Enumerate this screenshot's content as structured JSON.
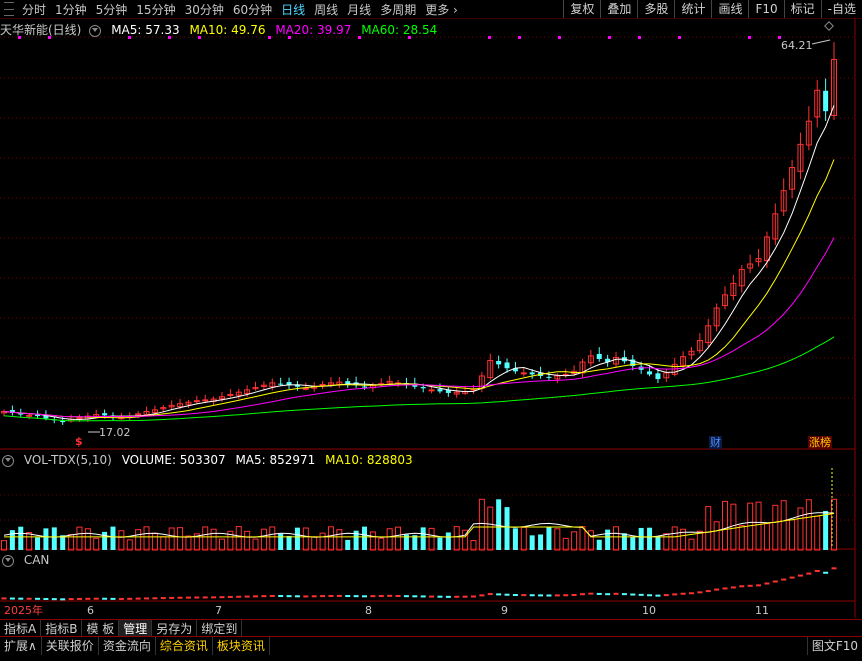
{
  "toolbar": {
    "periods": [
      "分时",
      "1分钟",
      "5分钟",
      "15分钟",
      "30分钟",
      "60分钟",
      "日线",
      "周线",
      "月线",
      "多周期",
      "更多"
    ],
    "active_period": "日线",
    "more_arrow": "›",
    "right_tools": [
      "复权",
      "叠加",
      "多股",
      "统计",
      "画线",
      "F10",
      "标记",
      "-自选"
    ]
  },
  "main_panel": {
    "title": "天华新能(日线)",
    "ma5": "MA5: 57.33",
    "ma10": "MA10: 49.76",
    "ma20": "MA20: 39.97",
    "ma60": "MA60: 28.54",
    "high_label": "64.21",
    "low_label": "17.02",
    "low_marker": "$",
    "tag_cai": "财",
    "tag_zhangbang": "涨榜",
    "colors": {
      "ma5": "#ffffff",
      "ma10": "#ffff00",
      "ma20": "#ff00ff",
      "ma60": "#00ff00",
      "up": "#ff3232",
      "down": "#54ffff"
    }
  },
  "volume_panel": {
    "title": "VOL-TDX(5,10)",
    "volume": "VOLUME: 503307",
    "ma5": "MA5: 852971",
    "ma10": "MA10: 828803"
  },
  "can_panel": {
    "title": "CAN"
  },
  "x_axis": {
    "year": "2025年",
    "months": [
      "6",
      "7",
      "8",
      "9",
      "10",
      "11"
    ]
  },
  "bottom_tabs_1": [
    "指标A",
    "指标B",
    "模 板",
    "管理",
    "另存为",
    "绑定到"
  ],
  "bottom_tabs_2": [
    "扩展∧",
    "关联报价",
    "资金流向",
    "综合资讯",
    "板块资讯"
  ],
  "bottom_right": "图文F10",
  "chart_data": {
    "type": "candlestick",
    "title": "天华新能(日线)",
    "annotated_high": 64.21,
    "annotated_low": 17.02,
    "x_month_labels": [
      "6",
      "7",
      "8",
      "9",
      "10",
      "11"
    ],
    "close_series": [
      18.4,
      18.2,
      18.0,
      17.9,
      17.8,
      17.5,
      17.3,
      17.02,
      17.4,
      17.6,
      17.8,
      18.0,
      17.9,
      17.7,
      17.6,
      17.8,
      18.1,
      18.4,
      18.6,
      18.9,
      19.2,
      19.4,
      19.6,
      19.8,
      19.9,
      20.0,
      20.3,
      20.6,
      20.9,
      21.2,
      21.5,
      21.8,
      22.1,
      22.0,
      21.8,
      21.6,
      21.4,
      21.6,
      21.9,
      22.1,
      22.2,
      22.0,
      21.8,
      21.6,
      21.8,
      22.0,
      22.3,
      22.1,
      21.8,
      21.6,
      21.4,
      21.2,
      21.0,
      20.8,
      20.9,
      21.0,
      21.3,
      23.0,
      25.0,
      24.5,
      24.0,
      23.6,
      23.4,
      23.2,
      23.0,
      22.8,
      23.0,
      23.2,
      23.6,
      24.8,
      25.6,
      25.2,
      24.8,
      25.4,
      24.9,
      24.3,
      23.8,
      23.2,
      22.6,
      23.4,
      24.5,
      25.5,
      26.2,
      27.6,
      29.5,
      31.8,
      33.5,
      35.0,
      36.8,
      37.5,
      38.2,
      41.0,
      44.0,
      47.0,
      50.0,
      53.0,
      56.0,
      60.0,
      57.3,
      64.0
    ]
  }
}
